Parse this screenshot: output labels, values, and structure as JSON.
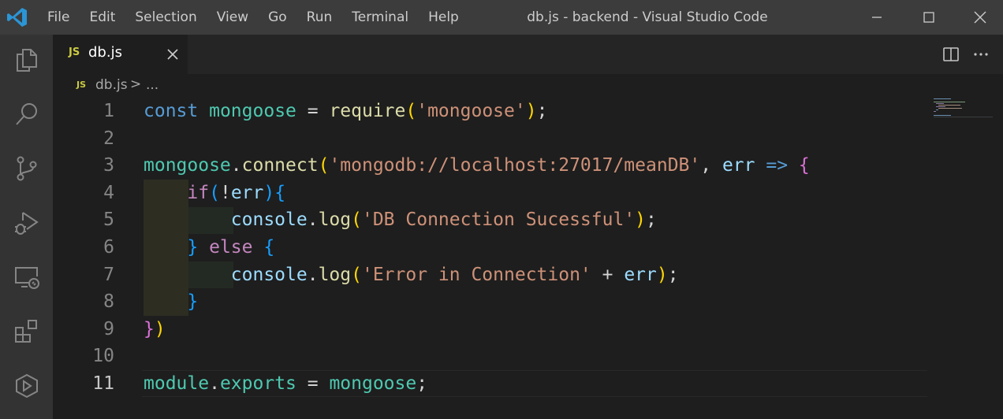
{
  "window": {
    "title": "db.js - backend - Visual Studio Code",
    "menu": [
      "File",
      "Edit",
      "Selection",
      "View",
      "Go",
      "Run",
      "Terminal",
      "Help"
    ]
  },
  "activity_bar": {
    "items": [
      "explorer",
      "search",
      "source-control",
      "run-and-debug",
      "remote-explorer",
      "extensions",
      "testing"
    ]
  },
  "tab": {
    "icon_text": "JS",
    "label": "db.js"
  },
  "breadcrumb": {
    "icon_text": "JS",
    "file": "db.js",
    "separator": ">",
    "more": "..."
  },
  "editor": {
    "active_line": 11,
    "lines": [
      {
        "n": "1",
        "tokens": [
          [
            "kw",
            "const"
          ],
          [
            "pun",
            " "
          ],
          [
            "var",
            "mongoose"
          ],
          [
            "pun",
            " = "
          ],
          [
            "fn",
            "require"
          ],
          [
            "b1",
            "("
          ],
          [
            "str",
            "'mongoose'"
          ],
          [
            "b1",
            ")"
          ],
          [
            "pun",
            ";"
          ]
        ]
      },
      {
        "n": "2",
        "tokens": []
      },
      {
        "n": "3",
        "tokens": [
          [
            "var",
            "mongoose"
          ],
          [
            "pun",
            "."
          ],
          [
            "fn",
            "connect"
          ],
          [
            "b1",
            "("
          ],
          [
            "str",
            "'mongodb://localhost:27017/meanDB'"
          ],
          [
            "pun",
            ", "
          ],
          [
            "prop",
            "err"
          ],
          [
            "pun",
            " "
          ],
          [
            "kw",
            "=>"
          ],
          [
            "pun",
            " "
          ],
          [
            "b2",
            "{"
          ]
        ]
      },
      {
        "n": "4",
        "tokens": [
          [
            "pun",
            "    "
          ],
          [
            "ctl",
            "if"
          ],
          [
            "b3",
            "("
          ],
          [
            "pun",
            "!"
          ],
          [
            "prop",
            "err"
          ],
          [
            "b3",
            ")"
          ],
          [
            "b3",
            "{"
          ]
        ]
      },
      {
        "n": "5",
        "tokens": [
          [
            "pun",
            "        "
          ],
          [
            "prop",
            "console"
          ],
          [
            "pun",
            "."
          ],
          [
            "fn",
            "log"
          ],
          [
            "b1",
            "("
          ],
          [
            "str",
            "'DB Connection Sucessful'"
          ],
          [
            "b1",
            ")"
          ],
          [
            "pun",
            ";"
          ]
        ]
      },
      {
        "n": "6",
        "tokens": [
          [
            "pun",
            "    "
          ],
          [
            "b3",
            "}"
          ],
          [
            "pun",
            " "
          ],
          [
            "ctl",
            "else"
          ],
          [
            "pun",
            " "
          ],
          [
            "b3",
            "{"
          ]
        ]
      },
      {
        "n": "7",
        "tokens": [
          [
            "pun",
            "        "
          ],
          [
            "prop",
            "console"
          ],
          [
            "pun",
            "."
          ],
          [
            "fn",
            "log"
          ],
          [
            "b1",
            "("
          ],
          [
            "str",
            "'Error in Connection'"
          ],
          [
            "pun",
            " + "
          ],
          [
            "prop",
            "err"
          ],
          [
            "b1",
            ")"
          ],
          [
            "pun",
            ";"
          ]
        ]
      },
      {
        "n": "8",
        "tokens": [
          [
            "pun",
            "    "
          ],
          [
            "b3",
            "}"
          ]
        ]
      },
      {
        "n": "9",
        "tokens": [
          [
            "b2",
            "}"
          ],
          [
            "b1",
            ")"
          ]
        ]
      },
      {
        "n": "10",
        "tokens": []
      },
      {
        "n": "11",
        "tokens": [
          [
            "var",
            "module"
          ],
          [
            "pun",
            "."
          ],
          [
            "var",
            "exports"
          ],
          [
            "pun",
            " = "
          ],
          [
            "var",
            "mongoose"
          ],
          [
            "pun",
            ";"
          ]
        ]
      }
    ]
  },
  "colors": {
    "keyword": "#569cd6",
    "control": "#c586c0",
    "variable": "#4ec9b0",
    "property": "#9cdcfe",
    "function": "#dcdcaa",
    "string": "#ce9178",
    "bracket1": "#ffd700",
    "bracket2": "#da70d6",
    "bracket3": "#179fff"
  }
}
